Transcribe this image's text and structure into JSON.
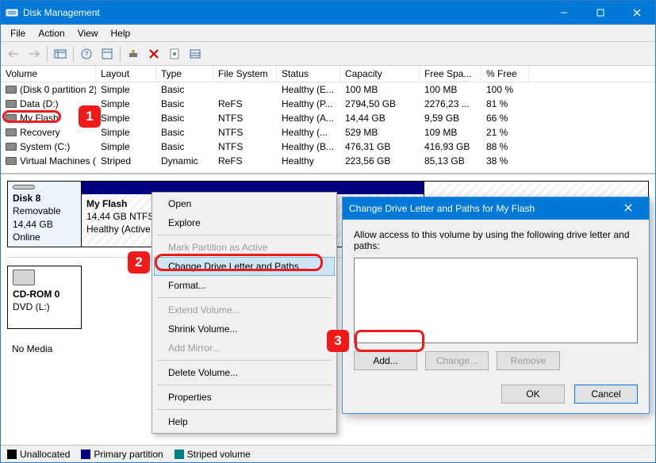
{
  "window": {
    "title": "Disk Management"
  },
  "menus": {
    "file": "File",
    "action": "Action",
    "view": "View",
    "help": "Help"
  },
  "columns": {
    "volume": "Volume",
    "layout": "Layout",
    "type": "Type",
    "fs": "File System",
    "status": "Status",
    "capacity": "Capacity",
    "free": "Free Spa...",
    "pfree": "% Free"
  },
  "volumes": [
    {
      "name": "(Disk 0 partition 2)",
      "layout": "Simple",
      "type": "Basic",
      "fs": "",
      "status": "Healthy (E...",
      "capacity": "100 MB",
      "free": "100 MB",
      "pfree": "100 %"
    },
    {
      "name": "Data (D:)",
      "layout": "Simple",
      "type": "Basic",
      "fs": "ReFS",
      "status": "Healthy (P...",
      "capacity": "2794,50 GB",
      "free": "2276,23 ...",
      "pfree": "81 %"
    },
    {
      "name": "My Flash",
      "layout": "Simple",
      "type": "Basic",
      "fs": "NTFS",
      "status": "Healthy (A...",
      "capacity": "14,44 GB",
      "free": "9,59 GB",
      "pfree": "66 %"
    },
    {
      "name": "Recovery",
      "layout": "Simple",
      "type": "Basic",
      "fs": "NTFS",
      "status": "Healthy (...",
      "capacity": "529 MB",
      "free": "109 MB",
      "pfree": "21 %"
    },
    {
      "name": "System (C:)",
      "layout": "Simple",
      "type": "Basic",
      "fs": "NTFS",
      "status": "Healthy (B...",
      "capacity": "476,31 GB",
      "free": "416,93 GB",
      "pfree": "88 %"
    },
    {
      "name": "Virtual Machines (...",
      "layout": "Striped",
      "type": "Dynamic",
      "fs": "ReFS",
      "status": "Healthy",
      "capacity": "223,56 GB",
      "free": "85,13 GB",
      "pfree": "38 %"
    }
  ],
  "disk8": {
    "title": "Disk 8",
    "type": "Removable",
    "size": "14,44 GB",
    "state": "Online",
    "part_name": "My Flash",
    "part_size": "14,44 GB NTFS",
    "part_status": "Healthy (Active, Primary Partition)"
  },
  "cdrom": {
    "title": "CD-ROM 0",
    "sub": "DVD (L:)",
    "nomedia": "No Media"
  },
  "context": {
    "open": "Open",
    "explore": "Explore",
    "markactive": "Mark Partition as Active",
    "changeletter": "Change Drive Letter and Paths...",
    "format": "Format...",
    "extend": "Extend Volume...",
    "shrink": "Shrink Volume...",
    "addmirror": "Add Mirror...",
    "delete": "Delete Volume...",
    "properties": "Properties",
    "help": "Help"
  },
  "dialog": {
    "title": "Change Drive Letter and Paths for My Flash",
    "instruction": "Allow access to this volume by using the following drive letter and paths:",
    "add": "Add...",
    "change": "Change...",
    "remove": "Remove",
    "ok": "OK",
    "cancel": "Cancel"
  },
  "legend": {
    "unalloc": "Unallocated",
    "primary": "Primary partition",
    "striped": "Striped volume"
  },
  "badges": {
    "one": "1",
    "two": "2",
    "three": "3"
  }
}
